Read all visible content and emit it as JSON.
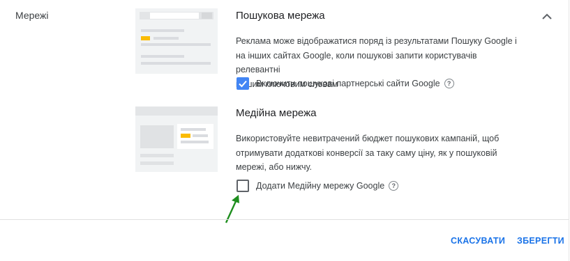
{
  "section": {
    "label": "Мережі"
  },
  "search_network": {
    "title": "Пошукова мережа",
    "description_lines": [
      "Реклама може відображатися поряд із результатами Пошуку Google і",
      "на інших сайтах Google, коли пошукові запити користувачів релевантні",
      "вашим ключовим словам"
    ],
    "checkbox_label": "Включити пошукові партнерські сайти Google",
    "checkbox_checked": true
  },
  "display_network": {
    "title": "Медійна мережа",
    "description_lines": [
      "Використовуйте невитрачений бюджет пошукових кампаній, щоб",
      "отримувати додаткові конверсії за таку саму ціну, як у пошуковій",
      "мережі, або нижчу."
    ],
    "checkbox_label": "Додати Медійну мережу Google",
    "checkbox_checked": false
  },
  "help_glyph": "?",
  "buttons": {
    "cancel": "СКАСУВАТИ",
    "save": "ЗБЕРЕГТИ"
  },
  "colors": {
    "accent": "#1a73e8",
    "checkbox_checked": "#4285f4",
    "illustration_highlight": "#fbbc04",
    "arrow": "#1e8e1e"
  },
  "icons": {
    "collapse": "chevron-up-icon",
    "help": "help-circle-icon",
    "check": "check-icon",
    "arrow": "green-arrow-icon"
  }
}
